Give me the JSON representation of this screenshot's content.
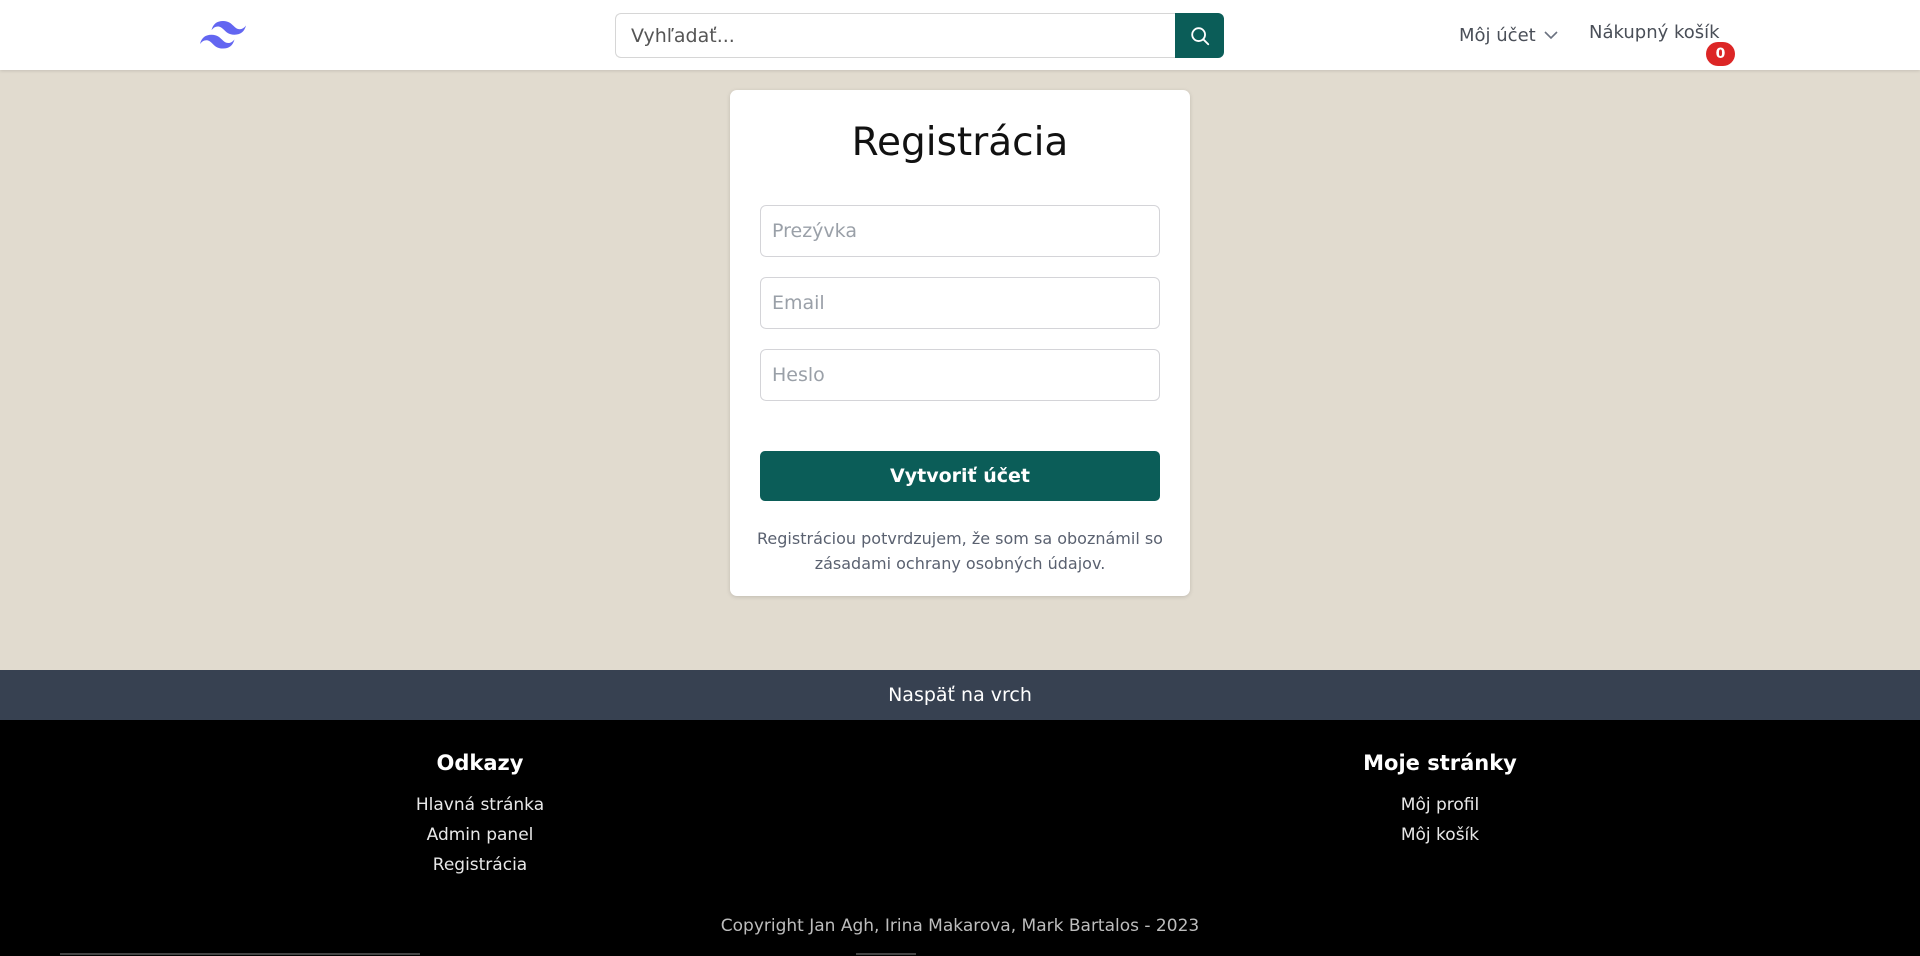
{
  "header": {
    "search_placeholder": "Vyhľadať...",
    "account_label": "Môj účet",
    "cart_label": "Nákupný košík",
    "cart_count": "0"
  },
  "card": {
    "title": "Registrácia",
    "nickname_placeholder": "Prezývka",
    "email_placeholder": "Email",
    "password_placeholder": "Heslo",
    "submit_label": "Vytvoriť účet",
    "consent_text": "Registráciou potvrdzujem, že som sa oboznámil so zásadami ochrany osobných údajov."
  },
  "back_to_top": "Naspäť na vrch",
  "footer": {
    "links_title": "Odkazy",
    "links": [
      "Hlavná stránka",
      "Admin panel",
      "Registrácia"
    ],
    "pages_title": "Moje stránky",
    "pages": [
      "Môj profil",
      "Môj košík"
    ],
    "copyright": "Copyright Jan Agh, Irina Makarova, Mark Bartalos - 2023"
  },
  "colors": {
    "brand": "#0b5d58",
    "page_bg": "#e1dbcf",
    "badge": "#dc2626",
    "logo": "#6366f1"
  },
  "icons": {
    "logo": "tailwind-logo-icon",
    "search": "search-icon",
    "account_chevron": "chevron-down-icon"
  }
}
